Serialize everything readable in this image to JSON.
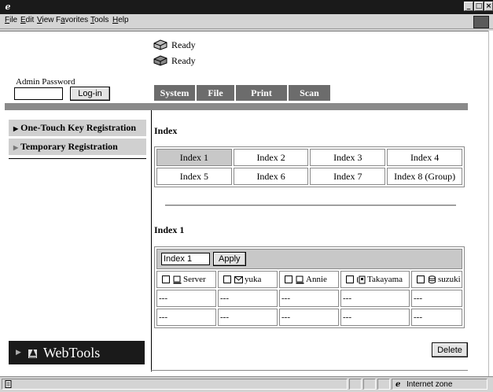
{
  "menu": {
    "items": [
      "File",
      "Edit",
      "View",
      "Favorites",
      "Tools",
      "Help"
    ],
    "underline": [
      "F",
      "E",
      "V",
      "a",
      "T",
      "H"
    ]
  },
  "status": {
    "lines": [
      "Ready",
      "Ready"
    ]
  },
  "login": {
    "label": "Admin Password",
    "password_value": "",
    "button": "Log-in"
  },
  "tabs": [
    "System",
    "File",
    "Print",
    "Scan"
  ],
  "sidebar": {
    "items": [
      "One-Touch Key Registration",
      "Temporary Registration"
    ],
    "logo_text": "WebTools"
  },
  "index": {
    "heading": "Index",
    "cells": [
      [
        "Index 1",
        "Index 2",
        "Index 3",
        "Index 4"
      ],
      [
        "Index 5",
        "Index 6",
        "Index 7",
        "Index 8 (Group)"
      ]
    ],
    "selected": "Index 1"
  },
  "detail": {
    "heading": "Index 1",
    "name_value": "Index 1",
    "apply": "Apply",
    "entries": [
      {
        "name": "Server",
        "icon": "computer-icon"
      },
      {
        "name": "yuka",
        "icon": "mail-icon"
      },
      {
        "name": "Annie",
        "icon": "computer-icon"
      },
      {
        "name": "Takayama",
        "icon": "fax-icon"
      },
      {
        "name": "suzuki",
        "icon": "database-icon"
      }
    ],
    "empty_rows": [
      [
        "---",
        "---",
        "---",
        "---",
        "---"
      ],
      [
        "---",
        "---",
        "---",
        "---",
        "---"
      ]
    ],
    "delete": "Delete"
  },
  "statusbar": {
    "zone": "Internet zone"
  }
}
